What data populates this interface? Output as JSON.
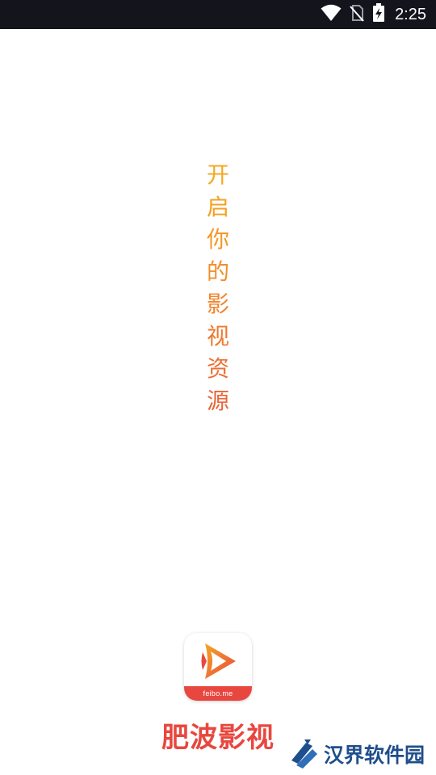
{
  "status_bar": {
    "time": "2:25",
    "icons": [
      "wifi-icon",
      "no-sim-icon",
      "battery-charging-icon"
    ]
  },
  "slogan": {
    "chars": [
      "开",
      "启",
      "你",
      "的",
      "影",
      "视",
      "资",
      "源"
    ],
    "colors": [
      "#f5a823",
      "#f4a024",
      "#f39727",
      "#f28e2a",
      "#f0842d",
      "#ee7a30",
      "#ec7034",
      "#ea6539"
    ]
  },
  "app": {
    "name": "肥波影视",
    "icon_domain": "feibo.me",
    "brand_color": "#e8473f"
  },
  "watermark": {
    "text": "汉界软件园",
    "icon": "watermark-logo-icon"
  }
}
